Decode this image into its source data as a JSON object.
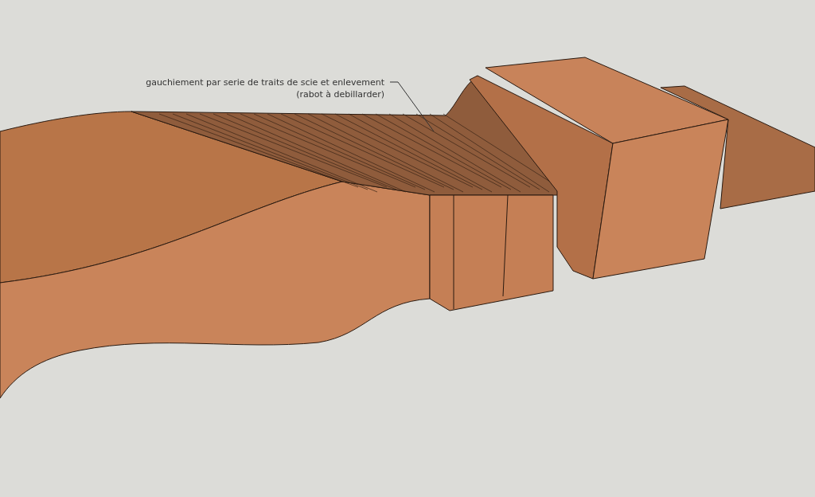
{
  "viewport": {
    "annotation": {
      "lines": [
        "gauchiement par serie de traits de scie et enlevement",
        "(rabot à debillarder)"
      ]
    }
  }
}
